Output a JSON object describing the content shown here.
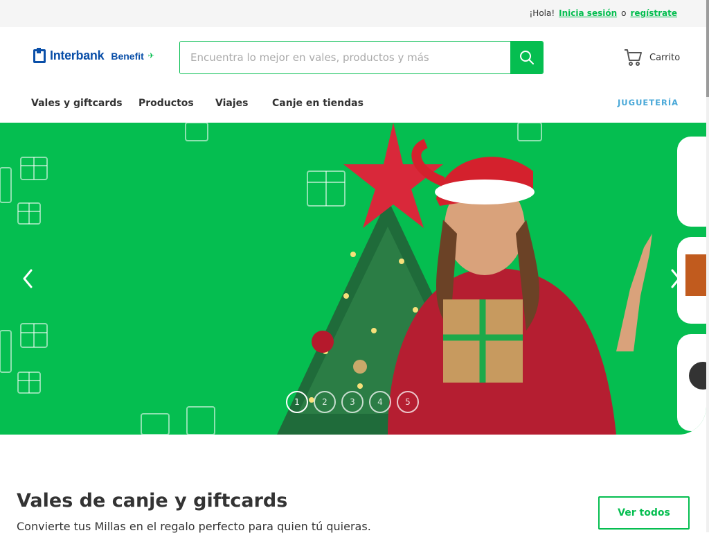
{
  "topbar": {
    "greeting": "¡Hola!",
    "login_label": "Inicia sesión",
    "or_label": "o",
    "register_label": "regístrate"
  },
  "header": {
    "logo_brand": "Interbank",
    "logo_sub": "Benefit",
    "search_placeholder": "Encuentra lo mejor en vales, productos y más",
    "cart_label": "Carrito"
  },
  "nav": {
    "items": [
      {
        "label": "Vales y giftcards"
      },
      {
        "label": "Productos"
      },
      {
        "label": "Viajes"
      },
      {
        "label": "Canje en tiendas"
      }
    ],
    "right_label": "JUGUETERÍA"
  },
  "hero": {
    "dots": [
      "1",
      "2",
      "3",
      "4",
      "5"
    ],
    "active_dot": 1
  },
  "section": {
    "title": "Vales de canje y giftcards",
    "subtitle": "Convierte tus Millas en el regalo perfecto para quien tú quieras.",
    "button_label": "Ver todos"
  },
  "colors": {
    "brand_green": "#05be50",
    "brand_blue": "#0a4fa8",
    "accent_lightblue": "#49a8d8"
  }
}
